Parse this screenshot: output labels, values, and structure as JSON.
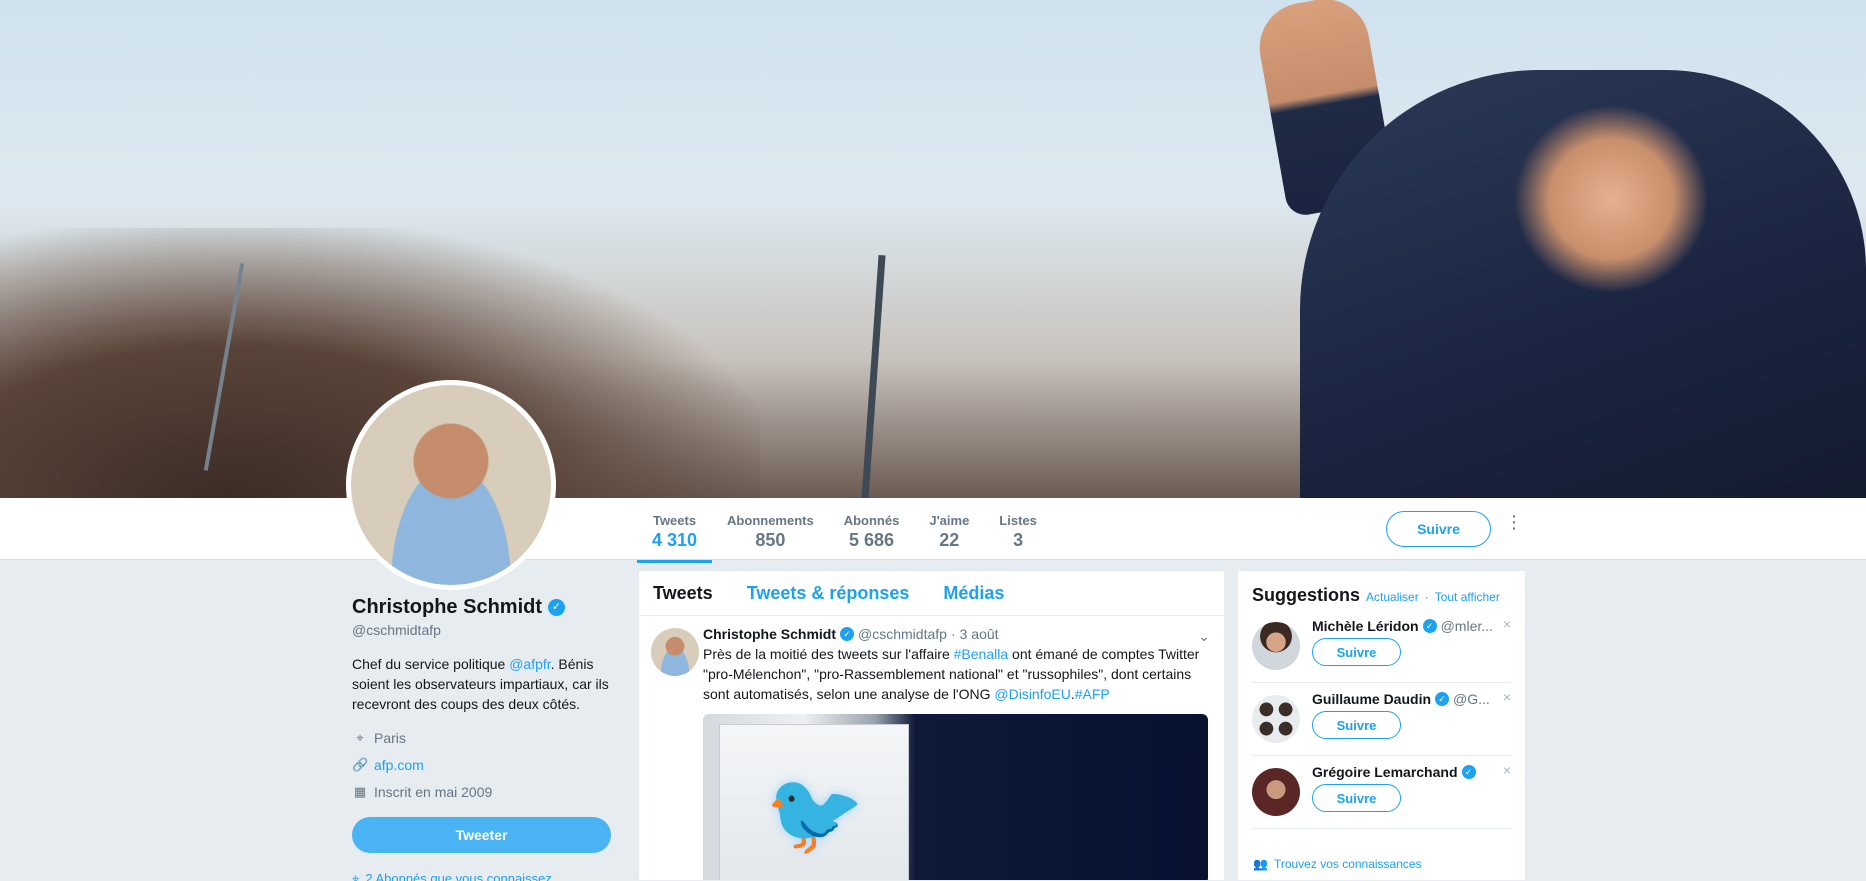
{
  "profile": {
    "name": "Christophe Schmidt",
    "handle": "@cschmidtafp",
    "bio_before": "Chef du service politique ",
    "bio_link": "@afpfr",
    "bio_after": ". Bénis soient les observateurs impartiaux, car ils recevront des coups des deux côtés.",
    "location": "Paris",
    "website": "afp.com",
    "joined": "Inscrit en mai 2009",
    "tweet_button": "Tweeter",
    "followers_hint": "2 Abonnés que vous connaissez"
  },
  "stats": [
    {
      "label": "Tweets",
      "value": "4 310"
    },
    {
      "label": "Abonnements",
      "value": "850"
    },
    {
      "label": "Abonnés",
      "value": "5 686"
    },
    {
      "label": "J'aime",
      "value": "22"
    },
    {
      "label": "Listes",
      "value": "3"
    }
  ],
  "follow_button": "Suivre",
  "timeline": {
    "tabs": [
      "Tweets",
      "Tweets & réponses",
      "Médias"
    ],
    "tweet": {
      "name": "Christophe Schmidt",
      "handle": "@cschmidtafp",
      "sep": "·",
      "time": "3 août",
      "text_1": "Près de la moitié des tweets sur l'affaire ",
      "hashtag_1": "#Benalla",
      "text_2": " ont émané de comptes Twitter \"pro-Mélenchon\", \"pro-Rassemblement national\" et \"russophiles\", dont certains sont automatisés, selon une analyse de l'ONG ",
      "mention": "@DisinfoEU",
      "dot": ".",
      "hashtag_2": "#AFP"
    }
  },
  "suggestions": {
    "title": "Suggestions",
    "sep": "·",
    "refresh": "Actualiser",
    "show_all": "Tout afficher",
    "items": [
      {
        "name": "Michèle Léridon",
        "handle": "@mler...",
        "button": "Suivre"
      },
      {
        "name": "Guillaume Daudin",
        "handle": "@G...",
        "button": "Suivre"
      },
      {
        "name": "Grégoire Lemarchand",
        "handle": "",
        "button": "Suivre"
      }
    ],
    "find_friends": "Trouvez vos connaissances"
  },
  "icons": {
    "verified": "✓",
    "close": "×",
    "chevron": "⌄",
    "more": "⋮",
    "location": "⌖",
    "link": "🔗",
    "calendar": "▦",
    "people": "👥",
    "twitter_bird": "🐦"
  },
  "colors": {
    "accent": "#1da1f2",
    "background": "#e6ecf0",
    "muted": "#657786"
  }
}
